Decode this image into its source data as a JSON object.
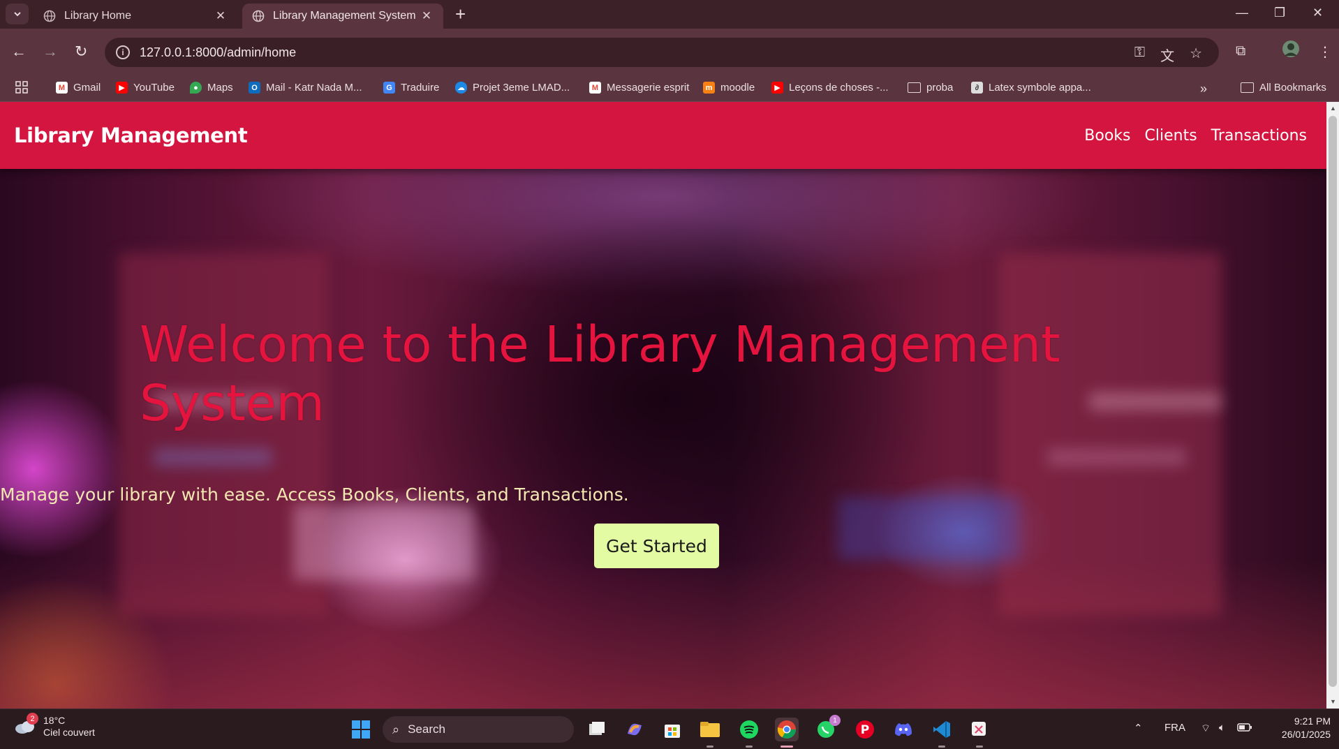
{
  "browser": {
    "tabs": [
      {
        "title": "Library Home",
        "active": false
      },
      {
        "title": "Library Management System",
        "active": true
      }
    ],
    "url": "127.0.0.1:8000/admin/home",
    "bookmarks": [
      {
        "label": "Gmail",
        "icon": "gmail-icon",
        "color": "#ea4335"
      },
      {
        "label": "YouTube",
        "icon": "youtube-icon",
        "color": "#ff0000"
      },
      {
        "label": "Maps",
        "icon": "maps-icon",
        "color": "#34a853"
      },
      {
        "label": "Mail - Katr Nada M...",
        "icon": "outlook-icon",
        "color": "#0f6cbd"
      },
      {
        "label": "Traduire",
        "icon": "translate-icon",
        "color": "#4285f4"
      },
      {
        "label": "Projet 3eme LMAD...",
        "icon": "onedrive-icon",
        "color": "#1e88e5"
      },
      {
        "label": "Messagerie esprit",
        "icon": "gmail-icon",
        "color": "#ea4335"
      },
      {
        "label": "moodle",
        "icon": "moodle-icon",
        "color": "#f98012"
      },
      {
        "label": "Leçons de choses -...",
        "icon": "youtube-icon",
        "color": "#ff0000"
      },
      {
        "label": "proba",
        "icon": "folder-icon",
        "color": ""
      },
      {
        "label": "Latex symbole appa...",
        "icon": "latex-icon",
        "color": "#dddddd"
      }
    ],
    "all_bookmarks": "All Bookmarks"
  },
  "page": {
    "brand": "Library Management",
    "nav": [
      "Books",
      "Clients",
      "Transactions"
    ],
    "hero_title": "Welcome to the Library Management System",
    "hero_subtitle": "Manage your library with ease. Access Books, Clients, and Transactions.",
    "cta": "Get Started",
    "colors": {
      "navbar": "#d3153f",
      "title": "#e4143f",
      "subtitle": "#f3e7b2",
      "cta_bg": "#e3fba3"
    }
  },
  "taskbar": {
    "weather_temp": "18°C",
    "weather_desc": "Ciel couvert",
    "weather_badge": "2",
    "search_placeholder": "Search",
    "whatsapp_badge": "1",
    "language": "FRA",
    "time": "9:21 PM",
    "date": "26/01/2025"
  }
}
